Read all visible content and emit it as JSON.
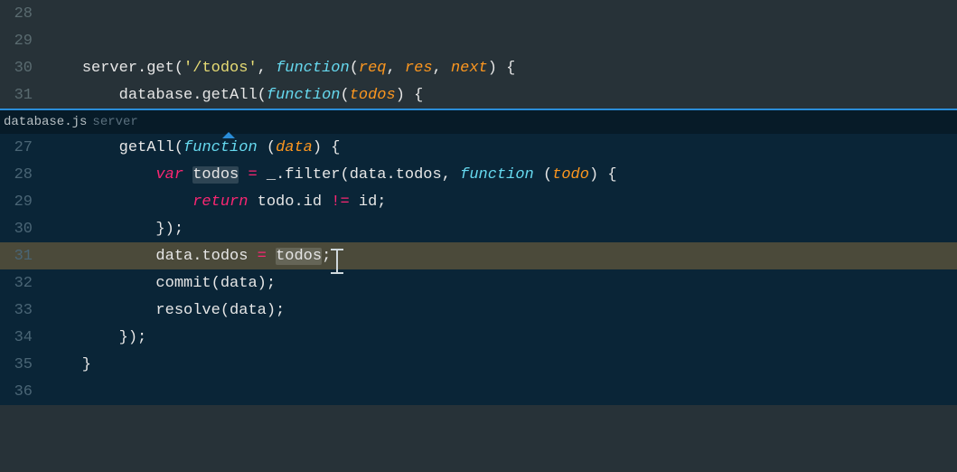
{
  "top": {
    "lines": [
      {
        "num": "28",
        "tokens": []
      },
      {
        "num": "29",
        "tokens": []
      },
      {
        "num": "30",
        "tokens": [
          {
            "t": "    ",
            "c": "ident"
          },
          {
            "t": "server",
            "c": "ident"
          },
          {
            "t": ".",
            "c": "punct"
          },
          {
            "t": "get",
            "c": "ident"
          },
          {
            "t": "(",
            "c": "punct"
          },
          {
            "t": "'/todos'",
            "c": "string"
          },
          {
            "t": ", ",
            "c": "punct"
          },
          {
            "t": "function",
            "c": "fn-kw"
          },
          {
            "t": "(",
            "c": "punct"
          },
          {
            "t": "req",
            "c": "param"
          },
          {
            "t": ", ",
            "c": "punct"
          },
          {
            "t": "res",
            "c": "param"
          },
          {
            "t": ", ",
            "c": "punct"
          },
          {
            "t": "next",
            "c": "param"
          },
          {
            "t": ") {",
            "c": "punct"
          }
        ]
      },
      {
        "num": "31",
        "tokens": [
          {
            "t": "        ",
            "c": "ident"
          },
          {
            "t": "database",
            "c": "ident"
          },
          {
            "t": ".",
            "c": "punct"
          },
          {
            "t": "getAll",
            "c": "ident"
          },
          {
            "t": "(",
            "c": "punct"
          },
          {
            "t": "function",
            "c": "fn-kw"
          },
          {
            "t": "(",
            "c": "punct"
          },
          {
            "t": "todos",
            "c": "param"
          },
          {
            "t": ") {",
            "c": "punct"
          }
        ]
      }
    ]
  },
  "peek": {
    "filename": "database.js",
    "path": "server"
  },
  "bottom": {
    "highlighted_index": 4,
    "lines": [
      {
        "num": "27",
        "tokens": [
          {
            "t": "        ",
            "c": "ident"
          },
          {
            "t": "getAll",
            "c": "ident"
          },
          {
            "t": "(",
            "c": "punct"
          },
          {
            "t": "function",
            "c": "fn-kw"
          },
          {
            "t": " (",
            "c": "punct"
          },
          {
            "t": "data",
            "c": "param"
          },
          {
            "t": ") {",
            "c": "punct"
          }
        ]
      },
      {
        "num": "28",
        "tokens": [
          {
            "t": "            ",
            "c": "ident"
          },
          {
            "t": "var",
            "c": "kw"
          },
          {
            "t": " ",
            "c": "ident"
          },
          {
            "t": "todos",
            "c": "ident",
            "sel": true
          },
          {
            "t": " ",
            "c": "ident"
          },
          {
            "t": "=",
            "c": "op"
          },
          {
            "t": " _",
            "c": "ident"
          },
          {
            "t": ".",
            "c": "punct"
          },
          {
            "t": "filter",
            "c": "ident"
          },
          {
            "t": "(",
            "c": "punct"
          },
          {
            "t": "data",
            "c": "ident"
          },
          {
            "t": ".",
            "c": "punct"
          },
          {
            "t": "todos",
            "c": "ident"
          },
          {
            "t": ", ",
            "c": "punct"
          },
          {
            "t": "function",
            "c": "fn-kw"
          },
          {
            "t": " (",
            "c": "punct"
          },
          {
            "t": "todo",
            "c": "param"
          },
          {
            "t": ") {",
            "c": "punct"
          }
        ]
      },
      {
        "num": "29",
        "tokens": [
          {
            "t": "                ",
            "c": "ident"
          },
          {
            "t": "return",
            "c": "kw"
          },
          {
            "t": " todo",
            "c": "ident"
          },
          {
            "t": ".",
            "c": "punct"
          },
          {
            "t": "id ",
            "c": "ident"
          },
          {
            "t": "!=",
            "c": "op"
          },
          {
            "t": " id;",
            "c": "ident"
          }
        ]
      },
      {
        "num": "30",
        "tokens": [
          {
            "t": "            });",
            "c": "punct"
          }
        ]
      },
      {
        "num": "31",
        "tokens": [
          {
            "t": "            ",
            "c": "ident"
          },
          {
            "t": "data",
            "c": "ident"
          },
          {
            "t": ".",
            "c": "punct"
          },
          {
            "t": "todos ",
            "c": "ident"
          },
          {
            "t": "=",
            "c": "op"
          },
          {
            "t": " ",
            "c": "ident"
          },
          {
            "t": "todos",
            "c": "ident",
            "sel": true
          },
          {
            "t": ";",
            "c": "punct",
            "cursor": true
          }
        ]
      },
      {
        "num": "32",
        "tokens": [
          {
            "t": "            ",
            "c": "ident"
          },
          {
            "t": "commit",
            "c": "ident"
          },
          {
            "t": "(",
            "c": "punct"
          },
          {
            "t": "data",
            "c": "ident"
          },
          {
            "t": ");",
            "c": "punct"
          }
        ]
      },
      {
        "num": "33",
        "tokens": [
          {
            "t": "            ",
            "c": "ident"
          },
          {
            "t": "resolve",
            "c": "ident"
          },
          {
            "t": "(",
            "c": "punct"
          },
          {
            "t": "data",
            "c": "ident"
          },
          {
            "t": ");",
            "c": "punct"
          }
        ]
      },
      {
        "num": "34",
        "tokens": [
          {
            "t": "        });",
            "c": "punct"
          }
        ]
      },
      {
        "num": "35",
        "tokens": [
          {
            "t": "    }",
            "c": "punct"
          }
        ]
      },
      {
        "num": "36",
        "tokens": []
      }
    ]
  }
}
